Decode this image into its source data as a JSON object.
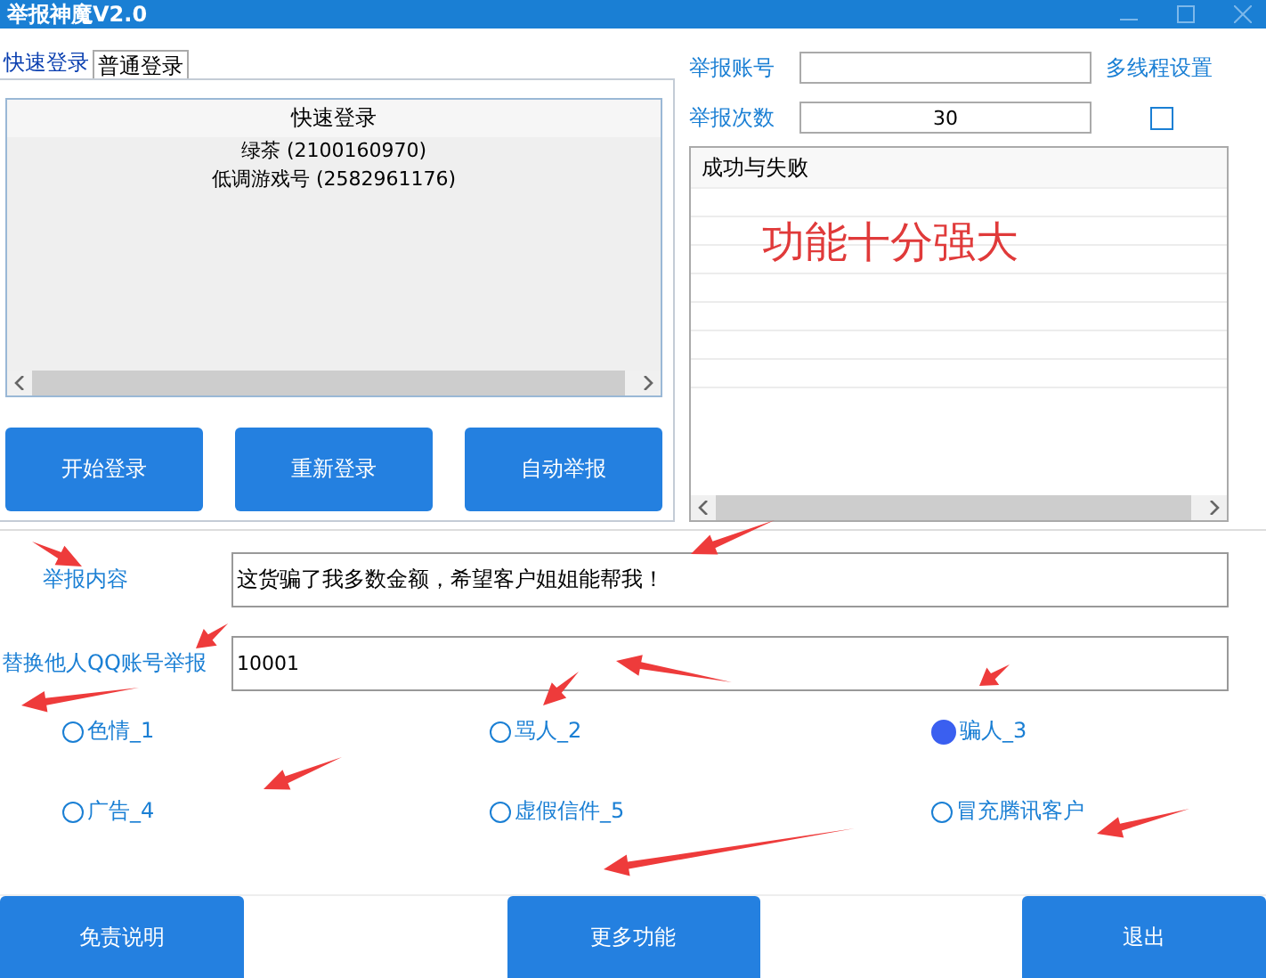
{
  "window": {
    "title": "举报神魔V2.0"
  },
  "tabs": [
    {
      "label": "快速登录",
      "selected": true
    },
    {
      "label": "普通登录",
      "selected": false
    }
  ],
  "login_list": {
    "header": "快速登录",
    "rows": [
      "绿茶 (2100160970)",
      "低调游戏号 (2582961176)"
    ]
  },
  "login_buttons": [
    "开始登录",
    "重新登录",
    "自动举报"
  ],
  "report_account": {
    "label": "举报账号"
  },
  "multithread": {
    "label": "多线程设置",
    "checked": false
  },
  "report_count": {
    "label": "举报次数",
    "value": "30"
  },
  "results": {
    "header": "成功与失败",
    "overlay_text": "功能十分强大"
  },
  "report_content": {
    "label": "举报内容",
    "value": "这货骗了我多数金额，希望客户姐姐能帮我！"
  },
  "replace_account": {
    "label": "替换他人QQ账号举报",
    "value": "10001"
  },
  "categories": [
    {
      "label": "色情_1",
      "selected": false
    },
    {
      "label": "骂人_2",
      "selected": false
    },
    {
      "label": "骗人_3",
      "selected": true
    },
    {
      "label": "广告_4",
      "selected": false
    },
    {
      "label": "虚假信件_5",
      "selected": false
    },
    {
      "label": "冒充腾讯客户",
      "selected": false
    }
  ],
  "footer_buttons": [
    "免责说明",
    "更多功能",
    "退出"
  ]
}
